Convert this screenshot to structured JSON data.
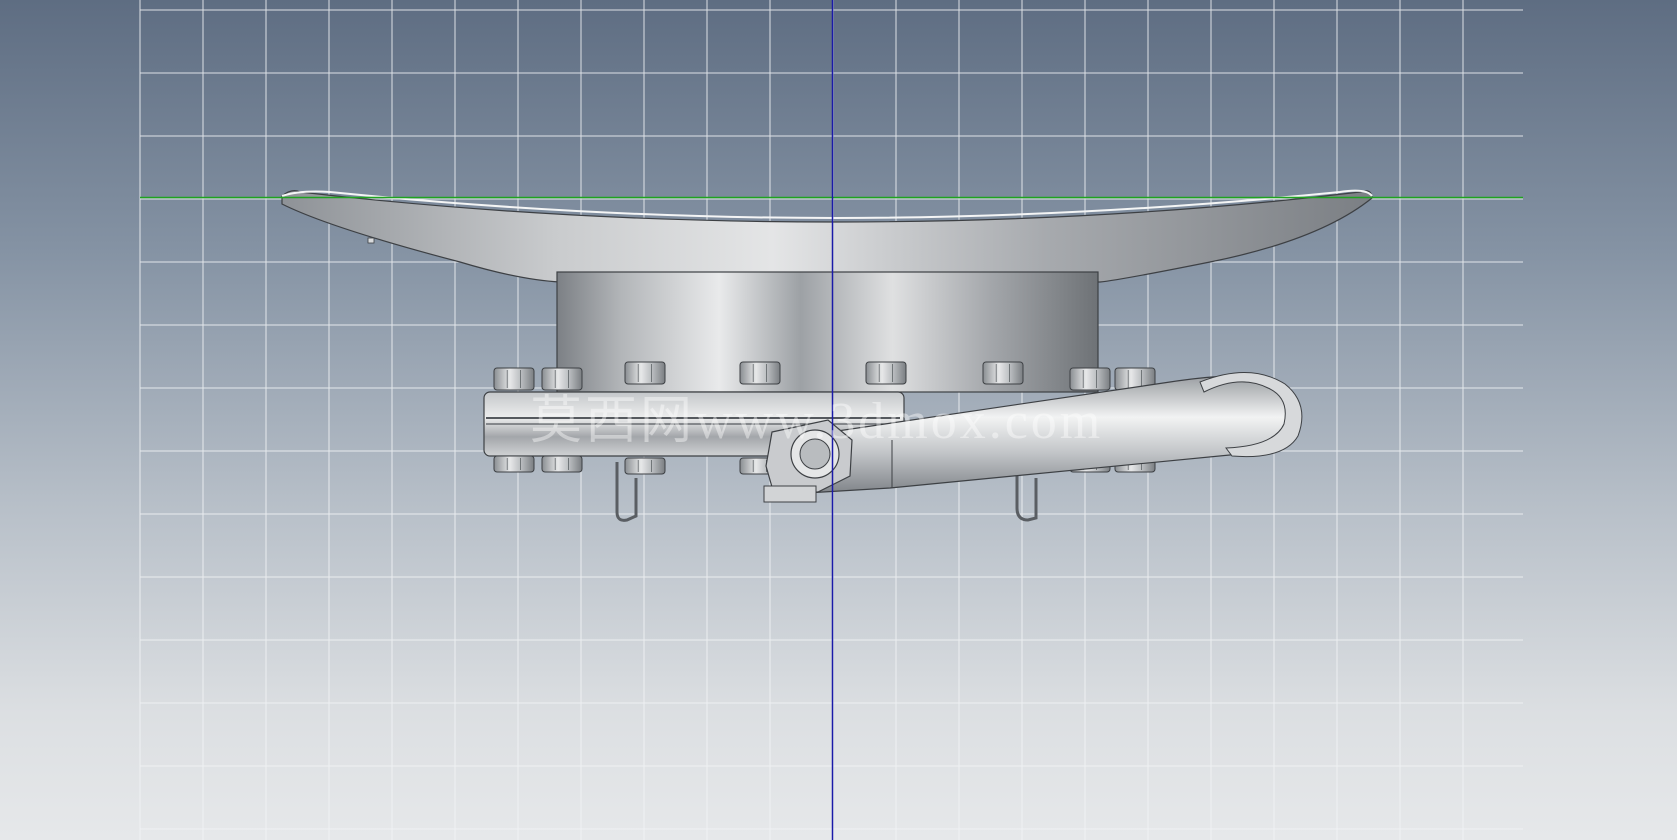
{
  "viewport": {
    "name": "cad-front-view",
    "background_top": "#5e6d82",
    "background_bottom": "#e6e8ea",
    "grid_color": "#f2f4f6",
    "horizontal_axis_color": "#1fa31f",
    "vertical_axis_color": "#1a1aa8"
  },
  "model": {
    "name": "flanged-dish-assembly",
    "metal_light": "#d8dadc",
    "metal_dark": "#6f7378",
    "bolt_count_visible": 16
  },
  "watermark": {
    "text": "莫西网www.3dmox.com"
  }
}
